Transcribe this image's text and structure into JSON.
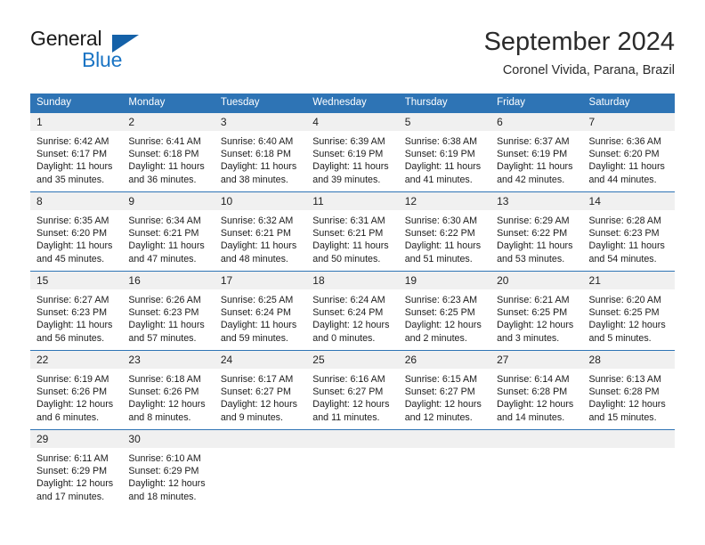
{
  "logo": {
    "primary_text": "General",
    "secondary_text": "Blue",
    "primary_color": "#1a1a1a",
    "secondary_color": "#1a74c4",
    "triangle_color": "#1461a8"
  },
  "header": {
    "title": "September 2024",
    "subtitle": "Coronel Vivida, Parana, Brazil"
  },
  "theme": {
    "header_bg": "#2e74b5",
    "header_text": "#ffffff",
    "day_number_bg": "#f0f0f0",
    "row_divider": "#2e74b5",
    "body_text": "#1c1c1c"
  },
  "weekdays": [
    "Sunday",
    "Monday",
    "Tuesday",
    "Wednesday",
    "Thursday",
    "Friday",
    "Saturday"
  ],
  "weeks": [
    [
      {
        "day": "1",
        "sunrise": "Sunrise: 6:42 AM",
        "sunset": "Sunset: 6:17 PM",
        "daylight": "Daylight: 11 hours and 35 minutes."
      },
      {
        "day": "2",
        "sunrise": "Sunrise: 6:41 AM",
        "sunset": "Sunset: 6:18 PM",
        "daylight": "Daylight: 11 hours and 36 minutes."
      },
      {
        "day": "3",
        "sunrise": "Sunrise: 6:40 AM",
        "sunset": "Sunset: 6:18 PM",
        "daylight": "Daylight: 11 hours and 38 minutes."
      },
      {
        "day": "4",
        "sunrise": "Sunrise: 6:39 AM",
        "sunset": "Sunset: 6:19 PM",
        "daylight": "Daylight: 11 hours and 39 minutes."
      },
      {
        "day": "5",
        "sunrise": "Sunrise: 6:38 AM",
        "sunset": "Sunset: 6:19 PM",
        "daylight": "Daylight: 11 hours and 41 minutes."
      },
      {
        "day": "6",
        "sunrise": "Sunrise: 6:37 AM",
        "sunset": "Sunset: 6:19 PM",
        "daylight": "Daylight: 11 hours and 42 minutes."
      },
      {
        "day": "7",
        "sunrise": "Sunrise: 6:36 AM",
        "sunset": "Sunset: 6:20 PM",
        "daylight": "Daylight: 11 hours and 44 minutes."
      }
    ],
    [
      {
        "day": "8",
        "sunrise": "Sunrise: 6:35 AM",
        "sunset": "Sunset: 6:20 PM",
        "daylight": "Daylight: 11 hours and 45 minutes."
      },
      {
        "day": "9",
        "sunrise": "Sunrise: 6:34 AM",
        "sunset": "Sunset: 6:21 PM",
        "daylight": "Daylight: 11 hours and 47 minutes."
      },
      {
        "day": "10",
        "sunrise": "Sunrise: 6:32 AM",
        "sunset": "Sunset: 6:21 PM",
        "daylight": "Daylight: 11 hours and 48 minutes."
      },
      {
        "day": "11",
        "sunrise": "Sunrise: 6:31 AM",
        "sunset": "Sunset: 6:21 PM",
        "daylight": "Daylight: 11 hours and 50 minutes."
      },
      {
        "day": "12",
        "sunrise": "Sunrise: 6:30 AM",
        "sunset": "Sunset: 6:22 PM",
        "daylight": "Daylight: 11 hours and 51 minutes."
      },
      {
        "day": "13",
        "sunrise": "Sunrise: 6:29 AM",
        "sunset": "Sunset: 6:22 PM",
        "daylight": "Daylight: 11 hours and 53 minutes."
      },
      {
        "day": "14",
        "sunrise": "Sunrise: 6:28 AM",
        "sunset": "Sunset: 6:23 PM",
        "daylight": "Daylight: 11 hours and 54 minutes."
      }
    ],
    [
      {
        "day": "15",
        "sunrise": "Sunrise: 6:27 AM",
        "sunset": "Sunset: 6:23 PM",
        "daylight": "Daylight: 11 hours and 56 minutes."
      },
      {
        "day": "16",
        "sunrise": "Sunrise: 6:26 AM",
        "sunset": "Sunset: 6:23 PM",
        "daylight": "Daylight: 11 hours and 57 minutes."
      },
      {
        "day": "17",
        "sunrise": "Sunrise: 6:25 AM",
        "sunset": "Sunset: 6:24 PM",
        "daylight": "Daylight: 11 hours and 59 minutes."
      },
      {
        "day": "18",
        "sunrise": "Sunrise: 6:24 AM",
        "sunset": "Sunset: 6:24 PM",
        "daylight": "Daylight: 12 hours and 0 minutes."
      },
      {
        "day": "19",
        "sunrise": "Sunrise: 6:23 AM",
        "sunset": "Sunset: 6:25 PM",
        "daylight": "Daylight: 12 hours and 2 minutes."
      },
      {
        "day": "20",
        "sunrise": "Sunrise: 6:21 AM",
        "sunset": "Sunset: 6:25 PM",
        "daylight": "Daylight: 12 hours and 3 minutes."
      },
      {
        "day": "21",
        "sunrise": "Sunrise: 6:20 AM",
        "sunset": "Sunset: 6:25 PM",
        "daylight": "Daylight: 12 hours and 5 minutes."
      }
    ],
    [
      {
        "day": "22",
        "sunrise": "Sunrise: 6:19 AM",
        "sunset": "Sunset: 6:26 PM",
        "daylight": "Daylight: 12 hours and 6 minutes."
      },
      {
        "day": "23",
        "sunrise": "Sunrise: 6:18 AM",
        "sunset": "Sunset: 6:26 PM",
        "daylight": "Daylight: 12 hours and 8 minutes."
      },
      {
        "day": "24",
        "sunrise": "Sunrise: 6:17 AM",
        "sunset": "Sunset: 6:27 PM",
        "daylight": "Daylight: 12 hours and 9 minutes."
      },
      {
        "day": "25",
        "sunrise": "Sunrise: 6:16 AM",
        "sunset": "Sunset: 6:27 PM",
        "daylight": "Daylight: 12 hours and 11 minutes."
      },
      {
        "day": "26",
        "sunrise": "Sunrise: 6:15 AM",
        "sunset": "Sunset: 6:27 PM",
        "daylight": "Daylight: 12 hours and 12 minutes."
      },
      {
        "day": "27",
        "sunrise": "Sunrise: 6:14 AM",
        "sunset": "Sunset: 6:28 PM",
        "daylight": "Daylight: 12 hours and 14 minutes."
      },
      {
        "day": "28",
        "sunrise": "Sunrise: 6:13 AM",
        "sunset": "Sunset: 6:28 PM",
        "daylight": "Daylight: 12 hours and 15 minutes."
      }
    ],
    [
      {
        "day": "29",
        "sunrise": "Sunrise: 6:11 AM",
        "sunset": "Sunset: 6:29 PM",
        "daylight": "Daylight: 12 hours and 17 minutes."
      },
      {
        "day": "30",
        "sunrise": "Sunrise: 6:10 AM",
        "sunset": "Sunset: 6:29 PM",
        "daylight": "Daylight: 12 hours and 18 minutes."
      },
      {
        "day": "",
        "sunrise": "",
        "sunset": "",
        "daylight": ""
      },
      {
        "day": "",
        "sunrise": "",
        "sunset": "",
        "daylight": ""
      },
      {
        "day": "",
        "sunrise": "",
        "sunset": "",
        "daylight": ""
      },
      {
        "day": "",
        "sunrise": "",
        "sunset": "",
        "daylight": ""
      },
      {
        "day": "",
        "sunrise": "",
        "sunset": "",
        "daylight": ""
      }
    ]
  ]
}
